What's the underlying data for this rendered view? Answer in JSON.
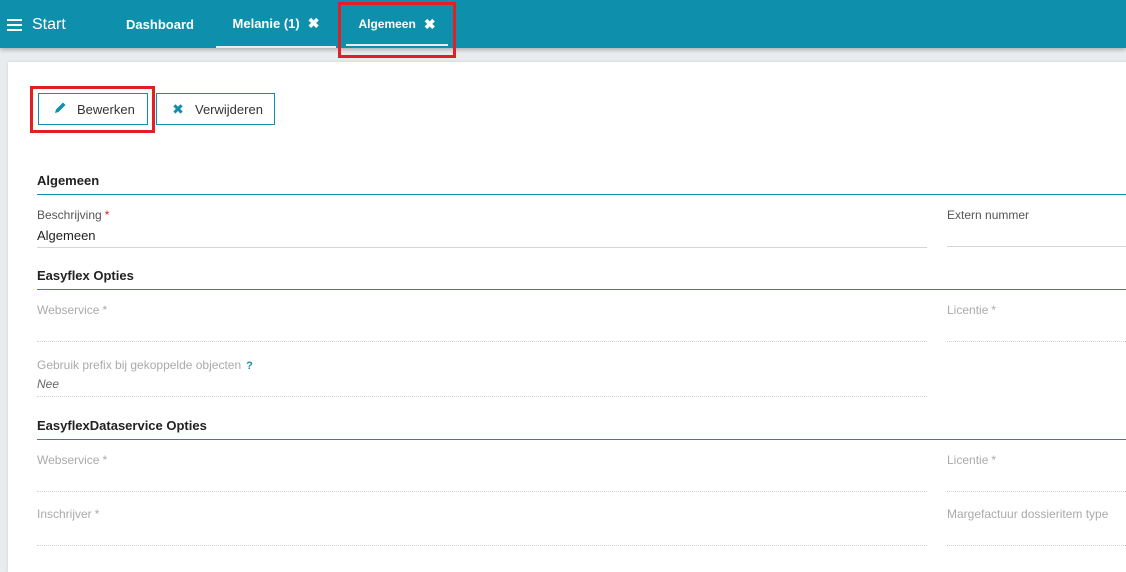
{
  "header": {
    "brand": "Start",
    "tabs": [
      {
        "label": "Dashboard",
        "closable": false
      },
      {
        "label": "Melanie (1)",
        "closable": true
      },
      {
        "label": "Algemeen",
        "closable": true
      }
    ],
    "close_glyph": "✖"
  },
  "toolbar": {
    "edit_label": "Bewerken",
    "delete_label": "Verwijderen"
  },
  "sections": {
    "algemeen": {
      "title": "Algemeen",
      "beschrijving_label": "Beschrijving",
      "beschrijving_value": "Algemeen",
      "extern_label": "Extern nummer"
    },
    "easyflex": {
      "title": "Easyflex Opties",
      "webservice_label": "Webservice",
      "licentie_label": "Licentie",
      "prefix_label": "Gebruik prefix bij gekoppelde objecten",
      "prefix_help": "?",
      "prefix_value": "Nee"
    },
    "dataservice": {
      "title": "EasyflexDataservice Opties",
      "webservice_label": "Webservice",
      "licentie_label": "Licentie",
      "inschrijver_label": "Inschrijver",
      "margefactuur_label": "Margefactuur dossieritem type"
    }
  },
  "required_mark": "*",
  "colors": {
    "accent": "#0e90ad",
    "highlight": "#e01f26",
    "required": "#d9232d"
  }
}
